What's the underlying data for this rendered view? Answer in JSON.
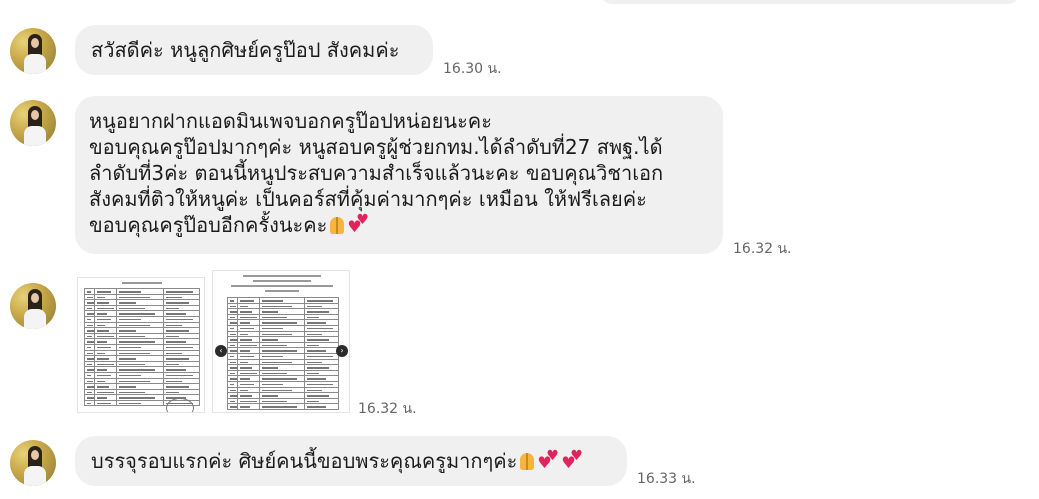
{
  "messages": [
    {
      "text_lines": [
        "สวัสดีค่ะ หนูลูกศิษย์ครูป๊อป สังคมค่ะ"
      ],
      "time": "16.30 น."
    },
    {
      "text_lines": [
        "หนูอยากฝากแอดมินเพจบอกครูป๊อปหน่อยนะคะ",
        "ขอบคุณครูป๊อปมากๆค่ะ หนูสอบครูผู้ช่วยกทม.ได้ลำดับที่27 สพฐ.ได้",
        "ลำดับที่3ค่ะ ตอนนี้หนูประสบความสำเร็จแล้วนะคะ ขอบคุณวิชาเอก",
        "สังคมที่ติวให้หนูค่ะ เป็นคอร์สที่คุ้มค่ามากๆค่ะ เหมือน ให้ฟรีเลยค่ะ",
        "ขอบคุณครูป๊อบอีกครั้งนะคะ"
      ],
      "time": "16.32 น."
    },
    {
      "attachment": "image-album",
      "time": "16.32 น."
    },
    {
      "text_lines": [
        "บรรจุรอบแรกค่ะ ศิษย์คนนี้ขอบพระคุณครูมากๆค่ะ"
      ],
      "time": "16.33 น."
    }
  ],
  "icons": {
    "pray": "folded-hands-emoji",
    "hearts": "two-hearts-emoji",
    "prev": "chevron-left-icon",
    "next": "chevron-right-icon"
  },
  "colors": {
    "bubble_bg": "#f0f0f0",
    "time_text": "#666666"
  }
}
